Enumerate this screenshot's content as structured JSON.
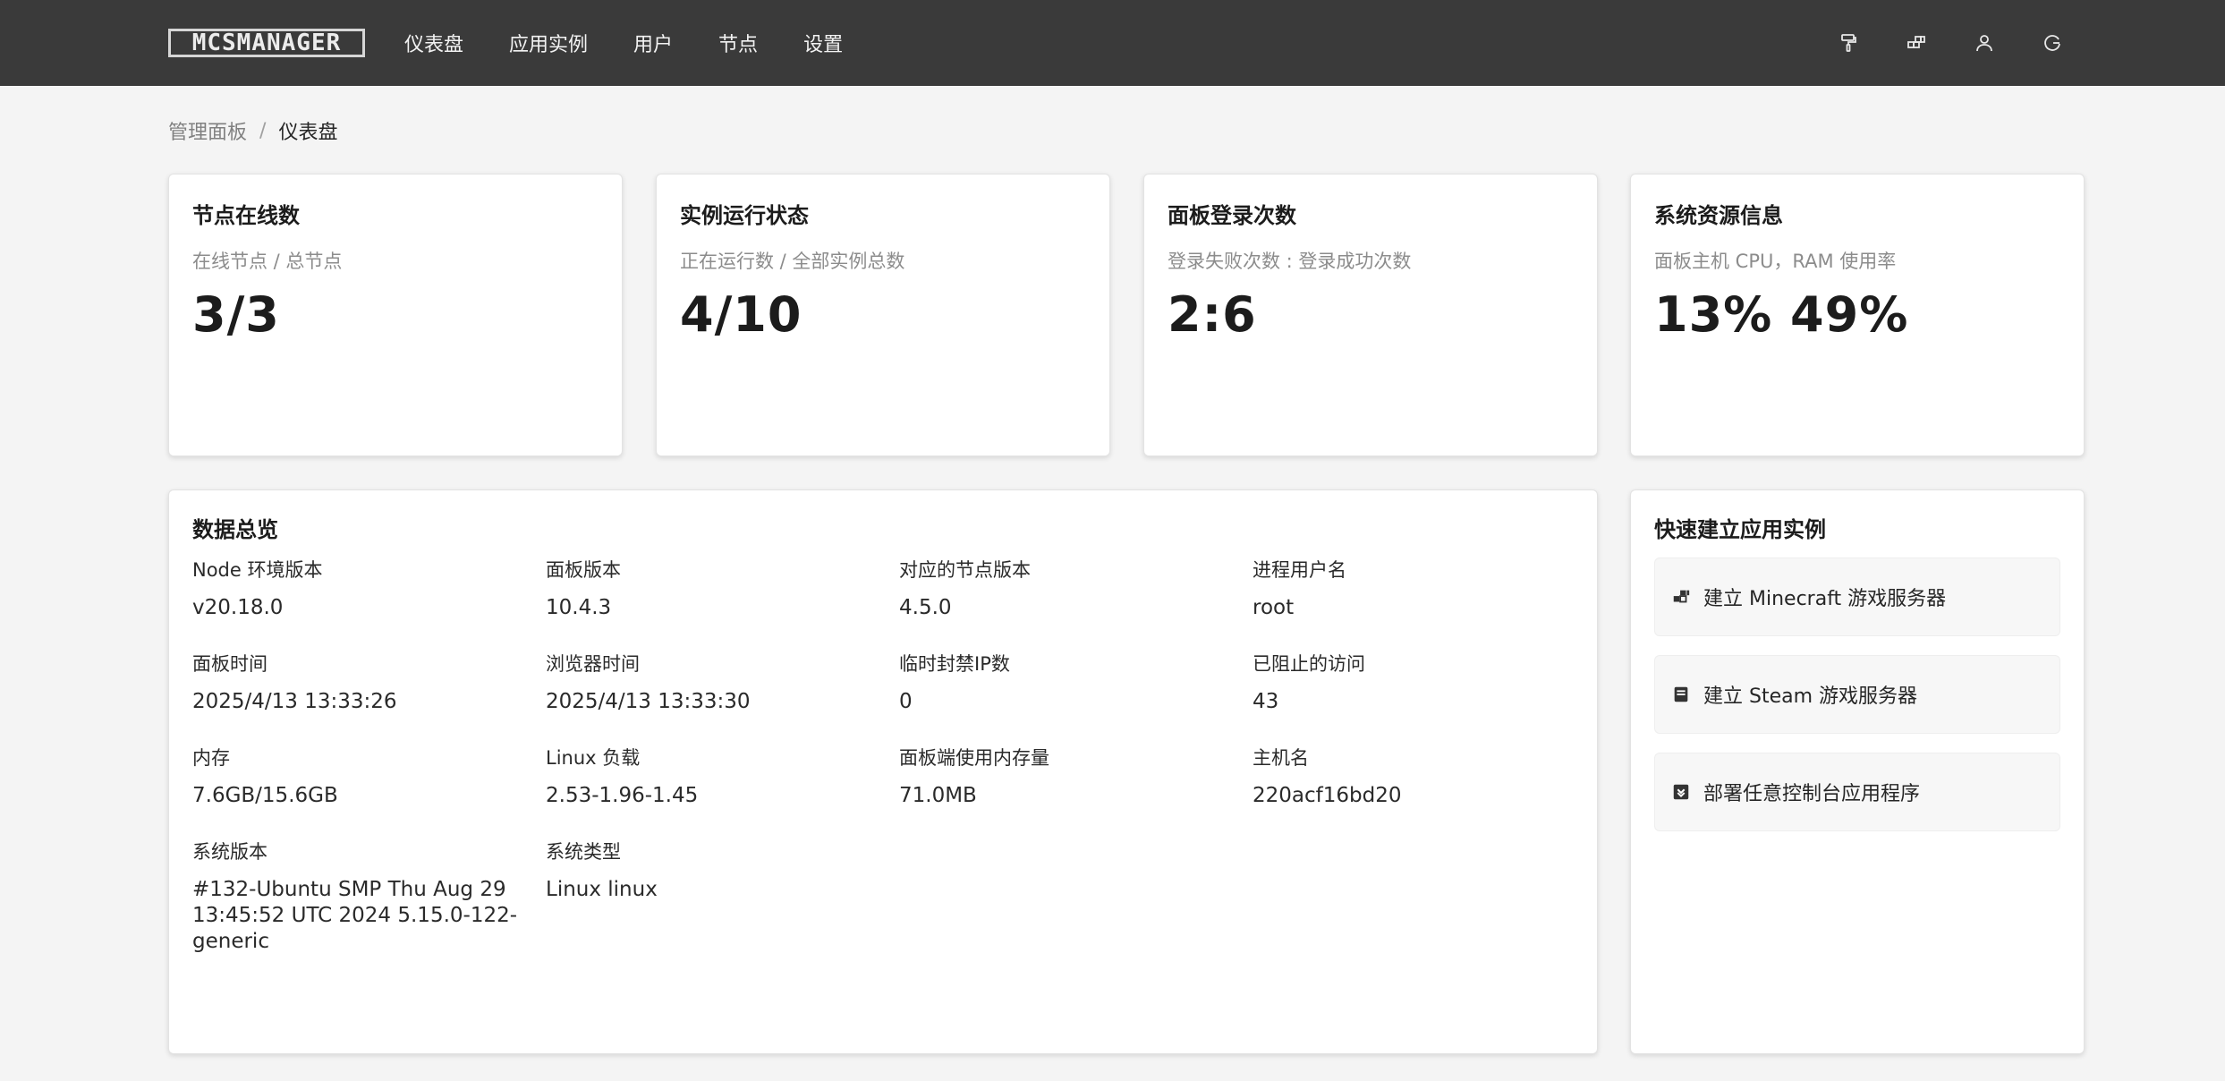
{
  "header": {
    "logo_text": "MCSMANAGER",
    "nav": [
      {
        "label": "仪表盘"
      },
      {
        "label": "应用实例"
      },
      {
        "label": "用户"
      },
      {
        "label": "节点"
      },
      {
        "label": "设置"
      }
    ],
    "actions": [
      {
        "icon": "paint-roller-icon"
      },
      {
        "icon": "blocks-icon"
      },
      {
        "icon": "user-icon"
      },
      {
        "icon": "logout-icon"
      }
    ]
  },
  "breadcrumb": {
    "parent": "管理面板",
    "separator": "/",
    "current": "仪表盘"
  },
  "stats": [
    {
      "title": "节点在线数",
      "subtitle": "在线节点 / 总节点",
      "value": "3/3"
    },
    {
      "title": "实例运行状态",
      "subtitle": "正在运行数 / 全部实例总数",
      "value": "4/10"
    },
    {
      "title": "面板登录次数",
      "subtitle": "登录失败次数 : 登录成功次数",
      "value": "2:6"
    },
    {
      "title": "系统资源信息",
      "subtitle": "面板主机 CPU，RAM 使用率",
      "value": "13% 49%"
    }
  ],
  "overview": {
    "title": "数据总览",
    "items": [
      {
        "label": "Node 环境版本",
        "value": "v20.18.0"
      },
      {
        "label": "面板版本",
        "value": "10.4.3"
      },
      {
        "label": "对应的节点版本",
        "value": "4.5.0"
      },
      {
        "label": "进程用户名",
        "value": "root"
      },
      {
        "label": "面板时间",
        "value": "2025/4/13 13:33:26"
      },
      {
        "label": "浏览器时间",
        "value": "2025/4/13 13:33:30"
      },
      {
        "label": "临时封禁IP数",
        "value": "0"
      },
      {
        "label": "已阻止的访问",
        "value": "43"
      },
      {
        "label": "内存",
        "value": "7.6GB/15.6GB"
      },
      {
        "label": "Linux 负载",
        "value": "2.53-1.96-1.45"
      },
      {
        "label": "面板端使用内存量",
        "value": "71.0MB"
      },
      {
        "label": "主机名",
        "value": "220acf16bd20"
      },
      {
        "label": "系统版本",
        "value": "#132-Ubuntu SMP Thu Aug 29 13:45:52 UTC 2024 5.15.0-122-generic"
      },
      {
        "label": "系统类型",
        "value": "Linux linux"
      }
    ]
  },
  "quick": {
    "title": "快速建立应用实例",
    "items": [
      {
        "label": "建立 Minecraft 游戏服务器",
        "icon": "minecraft-blocks-icon"
      },
      {
        "label": "建立 Steam 游戏服务器",
        "icon": "steam-box-icon"
      },
      {
        "label": "部署任意控制台应用程序",
        "icon": "download-box-icon"
      }
    ]
  }
}
